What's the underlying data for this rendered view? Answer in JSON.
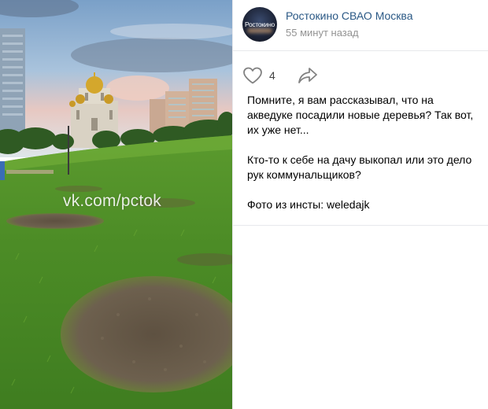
{
  "post": {
    "group_name": "Ростокино СВАО Москва",
    "time": "55 минут назад",
    "avatar_text": "Ростокино",
    "likes": "4",
    "paragraphs": [
      "Помните, я вам рассказывал, что на акведуке посадили новые деревья? Так вот, их уже нет...",
      "Кто-то к себе на дачу выкопал или это дело рук коммунальщиков?",
      "Фото из инсты: weledajk"
    ]
  },
  "photo": {
    "watermark": "vk.com/pctok"
  },
  "colors": {
    "link": "#2a5885",
    "muted": "#939393",
    "divider": "#e7e8ec",
    "icon": "#828282"
  },
  "icons": {
    "like": "heart-icon",
    "share": "share-arrow-icon"
  }
}
